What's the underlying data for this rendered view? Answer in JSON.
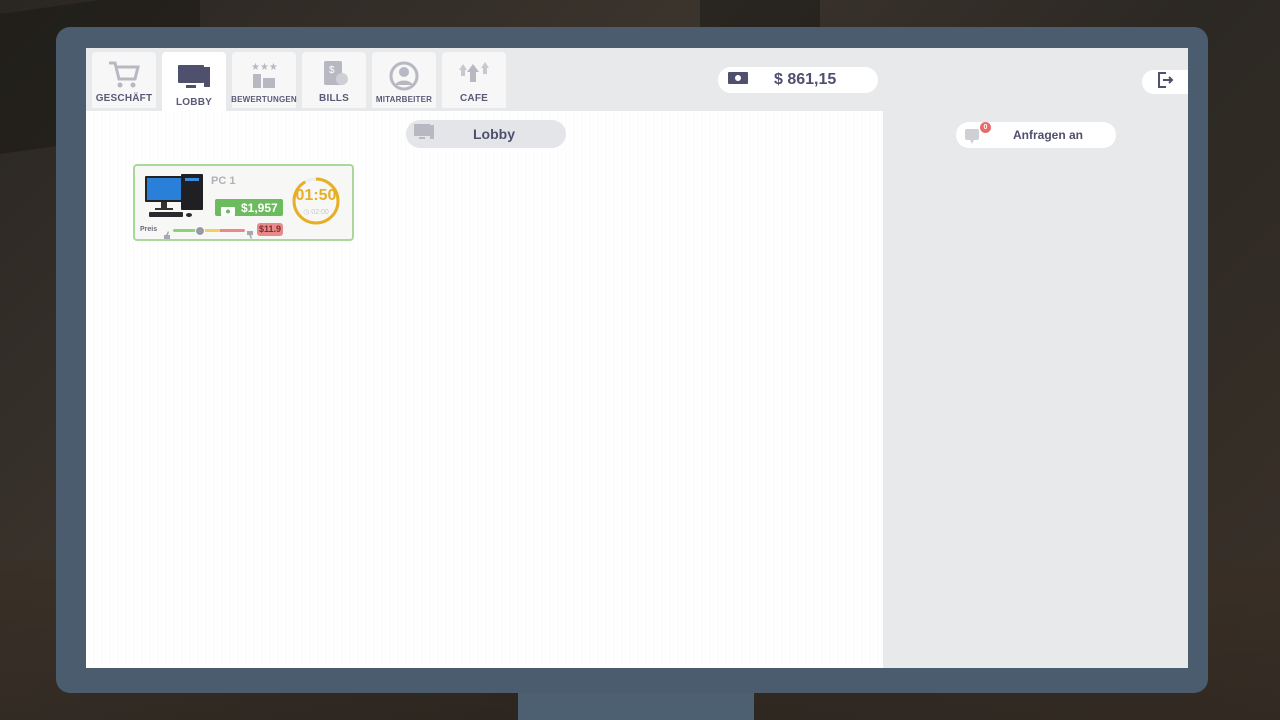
{
  "tabs": [
    {
      "label": "GESCHÄFT",
      "icon": "shopping-cart-icon"
    },
    {
      "label": "LOBBY",
      "icon": "monitor-icon"
    },
    {
      "label": "BEWERTUNGEN",
      "icon": "rating-thumbs-icon"
    },
    {
      "label": "BILLS",
      "icon": "bill-receipt-icon"
    },
    {
      "label": "MITARBEITER",
      "icon": "employee-user-icon"
    },
    {
      "label": "CAFE",
      "icon": "cafe-upgrade-icon"
    }
  ],
  "active_tab": "LOBBY",
  "header": {
    "balance": "$ 861,15"
  },
  "lobby": {
    "title": "Lobby",
    "pcs": [
      {
        "name": "PC 1",
        "price": "$1,957",
        "timer": "01:50",
        "timer_total": "02:00",
        "price_label": "Preis",
        "rate": "$11.9"
      }
    ]
  },
  "requests": {
    "label": "Anfragen an",
    "count": "0"
  },
  "colors": {
    "accent_text": "#4f4f6e",
    "money_green": "#6cbb5e",
    "timer_gold": "#e8ae24",
    "badge_red": "#e86a6a"
  }
}
